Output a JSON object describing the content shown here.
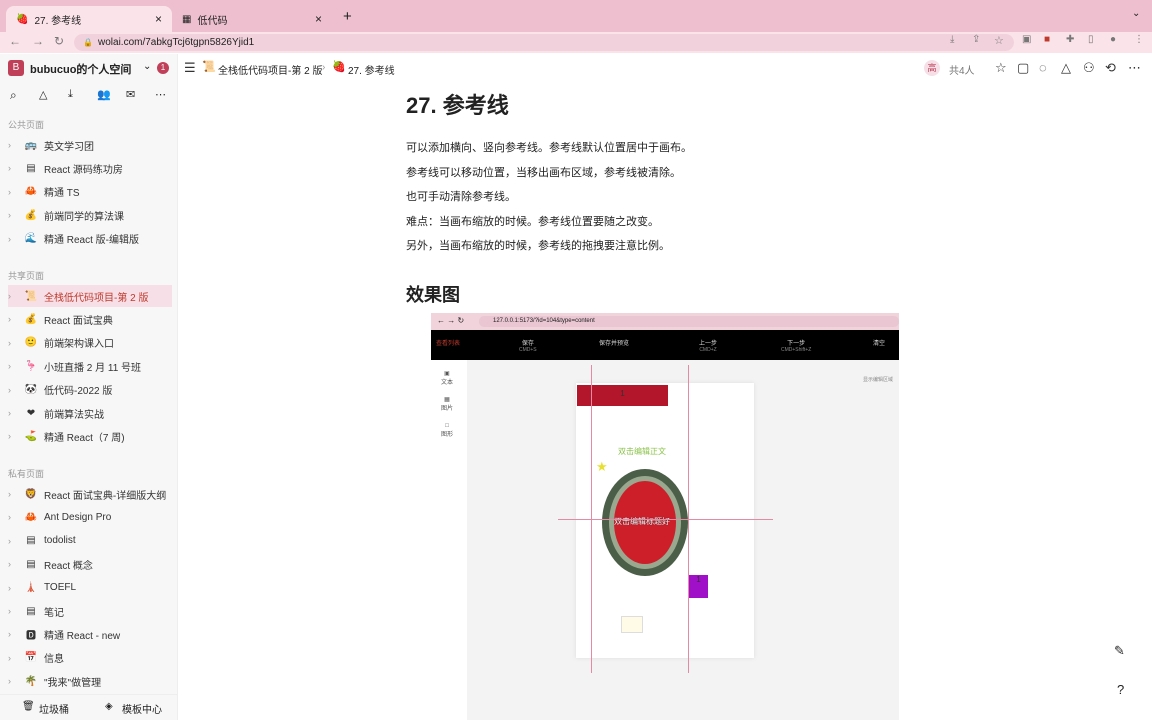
{
  "browser": {
    "tabs": [
      {
        "title": "27. 参考线",
        "active": true
      },
      {
        "title": "低代码",
        "active": false
      }
    ],
    "url": "wolai.com/7abkgTcj6tgpn5826Yjid1"
  },
  "sidebar": {
    "workspace": "bubucuo的个人空间",
    "badge": "1",
    "sections": [
      {
        "title": "公共页面",
        "items": [
          {
            "icon": "🚌",
            "label": "英文学习团"
          },
          {
            "icon": "▤",
            "label": "React 源码练功房"
          },
          {
            "icon": "🦀",
            "label": "精通 TS"
          },
          {
            "icon": "💰",
            "label": "前端同学的算法课"
          },
          {
            "icon": "🌊",
            "label": "精通 React 版-编辑版"
          }
        ]
      },
      {
        "title": "共享页面",
        "items": [
          {
            "icon": "📜",
            "label": "全栈低代码项目-第 2 版",
            "selected": true
          },
          {
            "icon": "💰",
            "label": "React 面试宝典"
          },
          {
            "icon": "🙂",
            "label": "前端架构课入口"
          },
          {
            "icon": "🦩",
            "label": "小班直播 2 月 11 号班"
          },
          {
            "icon": "🐼",
            "label": "低代码-2022 版"
          },
          {
            "icon": "❤",
            "label": "前端算法实战"
          },
          {
            "icon": "⛳",
            "label": "精通 React（7 周)"
          }
        ]
      },
      {
        "title": "私有页面",
        "items": [
          {
            "icon": "🦁",
            "label": "React 面试宝典-详细版大纲"
          },
          {
            "icon": "🦀",
            "label": "Ant Design Pro"
          },
          {
            "icon": "▤",
            "label": "todolist"
          },
          {
            "icon": "▤",
            "label": "React 概念"
          },
          {
            "icon": "🗼",
            "label": "TOEFL"
          },
          {
            "icon": "▤",
            "label": "笔记"
          },
          {
            "icon": "🅳",
            "label": "精通 React - new"
          },
          {
            "icon": "📅",
            "label": "信息"
          },
          {
            "icon": "🌴",
            "label": "\"我来\"做管理"
          }
        ]
      }
    ],
    "trash": "垃圾桶",
    "templates": "模板中心"
  },
  "topbar": {
    "breadcrumb": [
      "全栈低代码项目-第 2 版",
      "27. 参考线"
    ],
    "avatar": "高",
    "members": "共4人"
  },
  "doc": {
    "title": "27. 参考线",
    "paragraphs": [
      "可以添加横向、竖向参考线。参考线默认位置居中于画布。",
      "参考线可以移动位置，当移出画布区域，参考线被清除。",
      "也可手动清除参考线。",
      "难点：当画布缩放的时候。参考线位置要随之改变。",
      "另外，当画布缩放的时候，参考线的拖拽要注意比例。"
    ],
    "h2": "效果图"
  },
  "shot": {
    "url": "127.0.0.1:5173/?id=104&type=content",
    "list": "查看列表",
    "save": "保存",
    "save_key": "CMD+S",
    "save_preview": "保存并预览",
    "undo": "上一步",
    "undo_key": "CMD+Z",
    "redo": "下一步",
    "redo_key": "CMD+Shift+Z",
    "clear": "清空",
    "left": [
      "文本",
      "图片",
      "图形"
    ],
    "show_area": "显示编辑区域",
    "box_text": "1",
    "green_text": "双击编辑正文",
    "ellipse_text": "双击编辑标题好",
    "purple_text": "1"
  }
}
